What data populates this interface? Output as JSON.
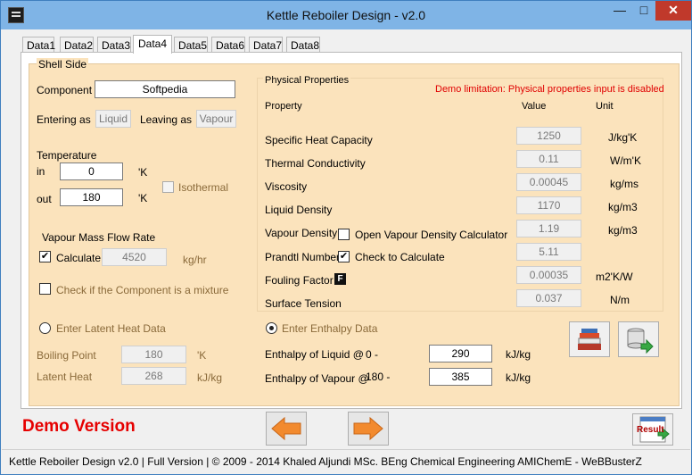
{
  "window": {
    "title": "Kettle Reboiler Design - v2.0",
    "min_glyph": "—",
    "max_glyph": "□",
    "close_glyph": "✕"
  },
  "tabs": [
    "Data1",
    "Data2",
    "Data3",
    "Data4",
    "Data5",
    "Data6",
    "Data7",
    "Data8"
  ],
  "active_tab": "Data4",
  "shell_side": {
    "legend": "Shell Side",
    "component_label": "Component",
    "component_value": "Softpedia",
    "entering_label": "Entering as",
    "entering_value": "Liquid",
    "leaving_label": "Leaving as",
    "leaving_value": "Vapour",
    "temperature_label": "Temperature",
    "in_label": "in",
    "in_value": "0",
    "in_unit": "'K",
    "out_label": "out",
    "out_value": "180",
    "out_unit": "'K",
    "isothermal_label": "Isothermal",
    "vapour_flow_label": "Vapour Mass Flow Rate",
    "calculate_label": "Calculate",
    "calculate_checked": true,
    "flow_value": "4520",
    "flow_unit": "kg/hr",
    "mixture_label": "Check if the Component is a mixture",
    "latent_radio_label": "Enter Latent Heat Data",
    "boiling_label": "Boiling Point",
    "boiling_value": "180",
    "boiling_unit": "'K",
    "latent_label": "Latent Heat",
    "latent_value": "268",
    "latent_unit": "kJ/kg"
  },
  "physical": {
    "legend": "Physical Properties",
    "demo_note": "Demo limitation: Physical properties input is disabled",
    "col_property": "Property",
    "col_value": "Value",
    "col_unit": "Unit",
    "rows": [
      {
        "name": "Specific Heat Capacity",
        "value": "1250",
        "unit": "J/kg'K"
      },
      {
        "name": "Thermal Conductivity",
        "value": "0.11",
        "unit": "W/m'K"
      },
      {
        "name": "Viscosity",
        "value": "0.00045",
        "unit": "kg/ms"
      },
      {
        "name": "Liquid Density",
        "value": "1170",
        "unit": "kg/m3"
      },
      {
        "name": "Vapour Density",
        "value": "1.19",
        "unit": "kg/m3"
      },
      {
        "name": "Prandtl Number",
        "value": "5.11",
        "unit": ""
      },
      {
        "name": "Fouling Factor",
        "value": "0.00035",
        "unit": "m2'K/W"
      },
      {
        "name": "Surface Tension",
        "value": "0.037",
        "unit": "N/m"
      }
    ],
    "vapour_calc_label": "Open Vapour Density Calculator",
    "check_calc_label": "Check to Calculate",
    "check_calc_checked": true,
    "fouling_badge": "F"
  },
  "enthalpy": {
    "radio_label": "Enter Enthalpy Data",
    "liquid_label": "Enthalpy of Liquid @",
    "liquid_range": "0 -",
    "liquid_value": "290",
    "liquid_unit": "kJ/kg",
    "vapour_label": "Enthalpy of Vapour @",
    "vapour_range": "180 -",
    "vapour_value": "385",
    "vapour_unit": "kJ/kg"
  },
  "footer": {
    "demo_text": "Demo Version",
    "result_label": "Result",
    "status": "Kettle Reboiler Design  v2.0  |  Full Version  |  © 2009 - 2014 Khaled Aljundi MSc. BEng Chemical Engineering AMIChemE - WeBBusterZ"
  },
  "colors": {
    "panel": "#fbe3bc",
    "accent_red": "#e60000",
    "arrow_orange": "#f28a2e"
  }
}
